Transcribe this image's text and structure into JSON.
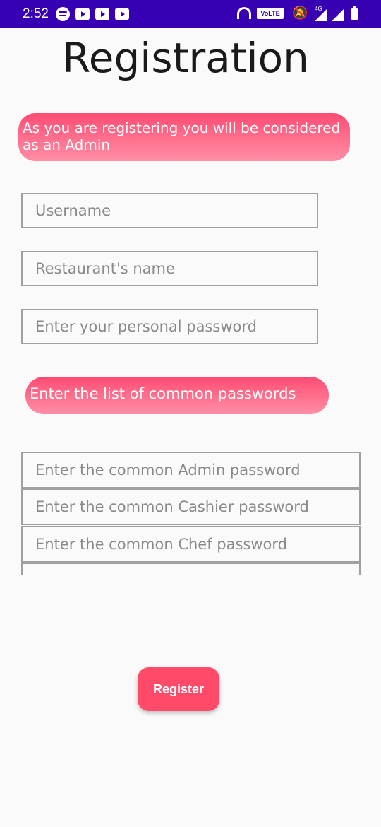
{
  "status_bar": {
    "time": "2:52",
    "volte_label": "VoLTE",
    "network_label": "4G",
    "icons": [
      "spotify-icon",
      "youtube-icon",
      "youtube-icon",
      "youtube-icon",
      "headphones-icon",
      "volte-icon",
      "bell-off-icon",
      "signal-icon",
      "signal-icon",
      "battery-icon"
    ],
    "background_color": "#3700b3"
  },
  "page": {
    "title": "Registration",
    "admin_notice": "As you are registering you will be considered as an Admin",
    "username_placeholder": "Username",
    "restaurant_placeholder": "Restaurant's name",
    "password_placeholder": "Enter your personal password",
    "common_passwords_header": "Enter the list of common passwords",
    "common_fields": [
      {
        "placeholder": "Enter the common Admin password"
      },
      {
        "placeholder": "Enter the common Cashier password"
      },
      {
        "placeholder": "Enter the common Chef password"
      },
      {
        "placeholder": ""
      }
    ],
    "register_label": "Register",
    "accent_color": "#ff4b69"
  }
}
